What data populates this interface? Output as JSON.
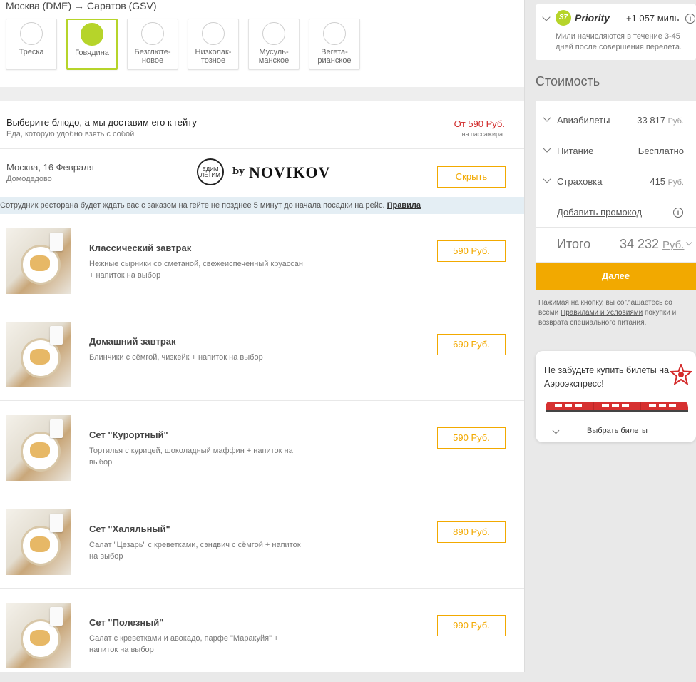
{
  "route": {
    "from": "Москва (DME)",
    "arrow": "→",
    "to": "Саратов (GSV)"
  },
  "diets": [
    {
      "l1": "Треска",
      "l2": "",
      "icon": "fish-icon"
    },
    {
      "l1": "Говядина",
      "l2": "",
      "icon": "cow-icon",
      "selected": true
    },
    {
      "l1": "Безглюте-",
      "l2": "новое",
      "icon": "gluten-free-icon"
    },
    {
      "l1": "Низколак-",
      "l2": "тозное",
      "icon": "lactose-free-icon"
    },
    {
      "l1": "Мусуль-",
      "l2": "манское",
      "icon": "crescent-icon"
    },
    {
      "l1": "Вегета-",
      "l2": "рианское",
      "icon": "leaf-icon"
    }
  ],
  "restaurant": {
    "promo_title": "Выберите блюдо, а мы доставим его к гейту",
    "promo_sub": "Еда, которую удобно взять с собой",
    "promo_price": "От 590 Руб.",
    "promo_price_sub": "на пассажира",
    "city": "Москва, 16 Февраля",
    "airport": "Домодедово",
    "logo_circle": "ЕДИМ ЛЕТИМ",
    "logo_by": "by",
    "logo_name": "NOVIKOV",
    "hide_label": "Скрыть",
    "notice": "Сотрудник ресторана будет ждать вас с заказом на гейте не позднее 5 минут до начала посадки на рейс.",
    "notice_link": "Правила"
  },
  "meals": [
    {
      "name": "Классический завтрак",
      "desc": "Нежные сырники со сметаной, свежеиспеченный круассан + напиток на выбор",
      "price": "590 Руб."
    },
    {
      "name": "Домашний завтрак",
      "desc": "Блинчики с сёмгой, чизкейк + напиток на выбор",
      "price": "690 Руб."
    },
    {
      "name": "Сет \"Курортный\"",
      "desc": "Тортилья с курицей, шоколадный маффин + напиток на выбор",
      "price": "590 Руб."
    },
    {
      "name": "Сет \"Халяльный\"",
      "desc": "Салат \"Цезарь\" с креветками, сэндвич с сёмгой + напиток на выбор",
      "price": "890 Руб."
    },
    {
      "name": "Сет \"Полезный\"",
      "desc": "Салат с креветками и авокадо, парфе \"Маракуйя\" + напиток на выбор",
      "price": "990 Руб."
    }
  ],
  "priority": {
    "badge": "S7",
    "label": "Priority",
    "miles": "+1 057 миль",
    "note": "Мили начисляются в течение 3-45 дней после совершения перелета."
  },
  "cost": {
    "title": "Стоимость",
    "rows": [
      {
        "k": "Авиабилеты",
        "v": "33 817",
        "cur": "Руб."
      },
      {
        "k": "Питание",
        "v": "Бесплатно",
        "cur": ""
      },
      {
        "k": "Страховка",
        "v": "415",
        "cur": "Руб."
      }
    ],
    "promo_link": "Добавить промокод",
    "total_label": "Итого",
    "total_value": "34 232",
    "total_cur": "Руб."
  },
  "next_button": "Далее",
  "agree": {
    "before": "Нажимая на кнопку, вы соглашаетесь со всеми ",
    "link": "Правилами и Условиями",
    "after": " покупки и возврата специального питания."
  },
  "aero": {
    "text": "Не забудьте купить билеты на Аэроэкспресс!",
    "link": "Выбрать билеты"
  },
  "colors": {
    "accent": "#f2a900",
    "green": "#b6d42a",
    "red": "#d12b2b"
  }
}
